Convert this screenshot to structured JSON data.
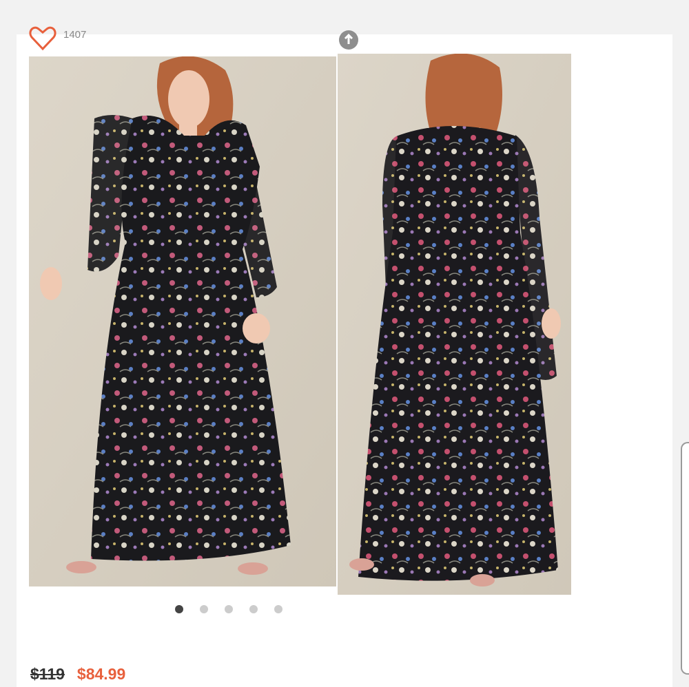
{
  "listing": {
    "like_count": "1407",
    "like_icon": "heart-outline-icon",
    "share_icon": "share-icon",
    "like_color": "#e8603c"
  },
  "gallery": {
    "photos": [
      {
        "name": "front-view",
        "alt": "Model wearing black floral long-sleeve maxi dress, front view"
      },
      {
        "name": "back-view",
        "alt": "Model wearing black floral long-sleeve maxi dress, back view"
      }
    ],
    "total_images": 5,
    "active_index": 0
  },
  "price": {
    "original": "$119",
    "sale": "$84.99",
    "sale_color": "#e8603c"
  }
}
